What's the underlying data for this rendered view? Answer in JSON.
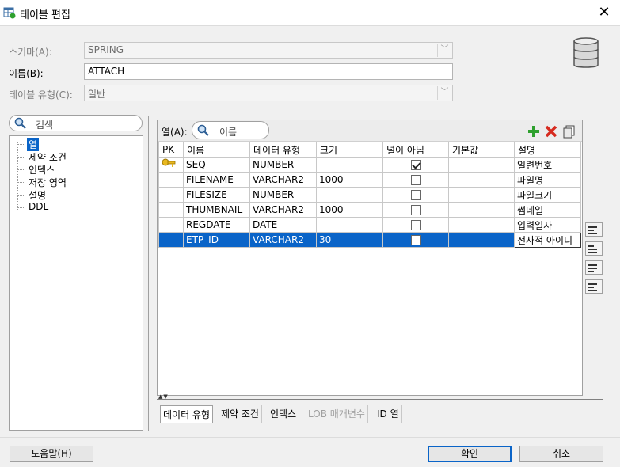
{
  "window": {
    "title": "테이블 편집",
    "close": "✕"
  },
  "form": {
    "schema_label": "스키마(A):",
    "schema_value": "SPRING",
    "name_label": "이름(B):",
    "name_value": "ATTACH",
    "type_label": "테이블 유형(C):",
    "type_value": "일반"
  },
  "nav": {
    "search_placeholder": "검색",
    "items": [
      "열",
      "제약 조건",
      "인덱스",
      "저장 영역",
      "설명",
      "DDL"
    ],
    "selected": "열"
  },
  "columns_panel": {
    "label": "열(A):",
    "search_placeholder": "이름",
    "toolbar": {
      "add": "add-column",
      "delete": "delete-column",
      "copy": "copy-column"
    },
    "headers": [
      "PK",
      "이름",
      "데이터 유형",
      "크기",
      "널이 아님",
      "기본값",
      "설명"
    ],
    "rows": [
      {
        "pk": true,
        "name": "SEQ",
        "type": "NUMBER",
        "size": "",
        "not_null": true,
        "default": "",
        "comment": "일련번호"
      },
      {
        "pk": false,
        "name": "FILENAME",
        "type": "VARCHAR2",
        "size": "1000",
        "not_null": false,
        "default": "",
        "comment": "파일명"
      },
      {
        "pk": false,
        "name": "FILESIZE",
        "type": "NUMBER",
        "size": "",
        "not_null": false,
        "default": "",
        "comment": "파일크기"
      },
      {
        "pk": false,
        "name": "THUMBNAIL",
        "type": "VARCHAR2",
        "size": "1000",
        "not_null": false,
        "default": "",
        "comment": "썸네일"
      },
      {
        "pk": false,
        "name": "REGDATE",
        "type": "DATE",
        "size": "",
        "not_null": false,
        "default": "",
        "comment": "입력일자"
      },
      {
        "pk": false,
        "name": "ETP_ID",
        "type": "VARCHAR2",
        "size": "30",
        "not_null": false,
        "default": "",
        "comment": "전사적 아이디"
      }
    ],
    "selected_row": 5
  },
  "bottom_tabs": [
    {
      "label": "데이터 유형",
      "enabled": true
    },
    {
      "label": "제약 조건",
      "enabled": true
    },
    {
      "label": "인덱스",
      "enabled": true
    },
    {
      "label": "LOB 매개변수",
      "enabled": false
    },
    {
      "label": "ID 열",
      "enabled": true
    }
  ],
  "buttons": {
    "help": "도움말(H)",
    "ok": "확인",
    "cancel": "취소"
  },
  "colors": {
    "selection": "#0a64c8",
    "add": "#2ea02e",
    "delete": "#d62a1e"
  }
}
